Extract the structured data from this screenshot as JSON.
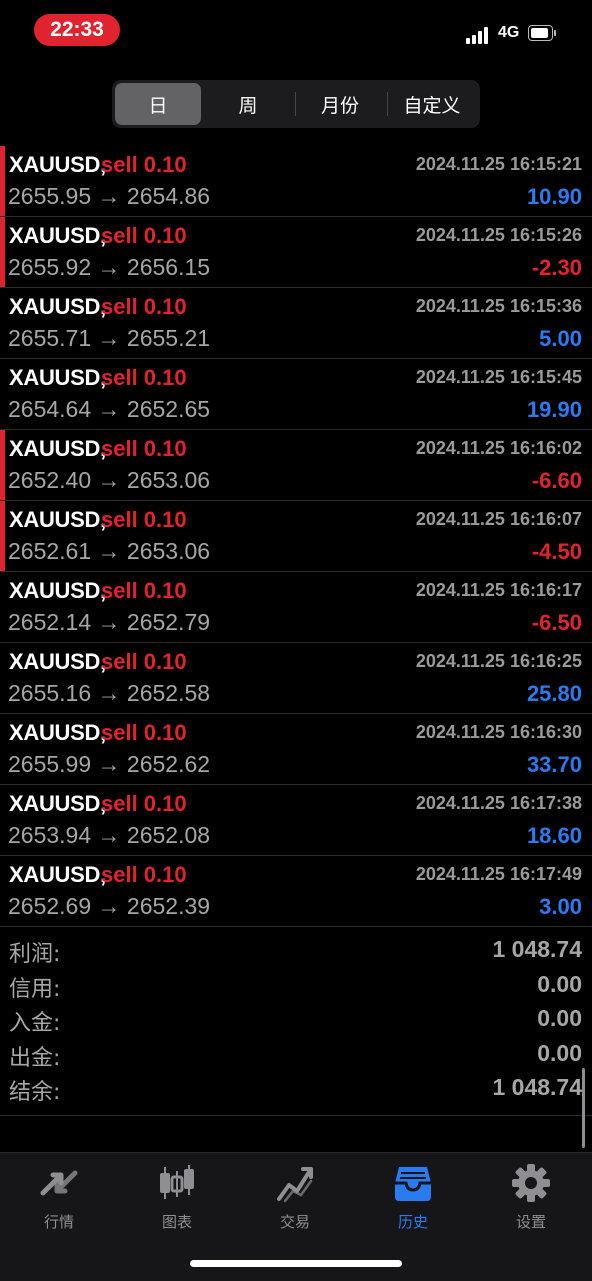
{
  "status_bar": {
    "time": "22:33",
    "network": "4G"
  },
  "period_tabs": [
    "日",
    "周",
    "月份",
    "自定义"
  ],
  "trades": [
    {
      "symbol": "XAUUSD,",
      "side": "sell 0.10",
      "prices": "2655.95 → 2654.86",
      "datetime": "2024.11.25 16:15:21",
      "profit": "10.90",
      "positive": true,
      "flag": true
    },
    {
      "symbol": "XAUUSD,",
      "side": "sell 0.10",
      "prices": "2655.92 → 2656.15",
      "datetime": "2024.11.25 16:15:26",
      "profit": "-2.30",
      "positive": false,
      "flag": true
    },
    {
      "symbol": "XAUUSD,",
      "side": "sell 0.10",
      "prices": "2655.71 → 2655.21",
      "datetime": "2024.11.25 16:15:36",
      "profit": "5.00",
      "positive": true,
      "flag": false
    },
    {
      "symbol": "XAUUSD,",
      "side": "sell 0.10",
      "prices": "2654.64 → 2652.65",
      "datetime": "2024.11.25 16:15:45",
      "profit": "19.90",
      "positive": true,
      "flag": false
    },
    {
      "symbol": "XAUUSD,",
      "side": "sell 0.10",
      "prices": "2652.40 → 2653.06",
      "datetime": "2024.11.25 16:16:02",
      "profit": "-6.60",
      "positive": false,
      "flag": true
    },
    {
      "symbol": "XAUUSD,",
      "side": "sell 0.10",
      "prices": "2652.61 → 2653.06",
      "datetime": "2024.11.25 16:16:07",
      "profit": "-4.50",
      "positive": false,
      "flag": true
    },
    {
      "symbol": "XAUUSD,",
      "side": "sell 0.10",
      "prices": "2652.14 → 2652.79",
      "datetime": "2024.11.25 16:16:17",
      "profit": "-6.50",
      "positive": false,
      "flag": false
    },
    {
      "symbol": "XAUUSD,",
      "side": "sell 0.10",
      "prices": "2655.16 → 2652.58",
      "datetime": "2024.11.25 16:16:25",
      "profit": "25.80",
      "positive": true,
      "flag": false
    },
    {
      "symbol": "XAUUSD,",
      "side": "sell 0.10",
      "prices": "2655.99 → 2652.62",
      "datetime": "2024.11.25 16:16:30",
      "profit": "33.70",
      "positive": true,
      "flag": false
    },
    {
      "symbol": "XAUUSD,",
      "side": "sell 0.10",
      "prices": "2653.94 → 2652.08",
      "datetime": "2024.11.25 16:17:38",
      "profit": "18.60",
      "positive": true,
      "flag": false
    },
    {
      "symbol": "XAUUSD,",
      "side": "sell 0.10",
      "prices": "2652.69 → 2652.39",
      "datetime": "2024.11.25 16:17:49",
      "profit": "3.00",
      "positive": true,
      "flag": false
    }
  ],
  "summary": [
    {
      "label": "利润:",
      "value": "1 048.74"
    },
    {
      "label": "信用:",
      "value": "0.00"
    },
    {
      "label": "入金:",
      "value": "0.00"
    },
    {
      "label": "出金:",
      "value": "0.00"
    },
    {
      "label": "结余:",
      "value": "1 048.74"
    }
  ],
  "tabbar": [
    {
      "label": "行情",
      "icon": "quotes-icon"
    },
    {
      "label": "图表",
      "icon": "chart-icon"
    },
    {
      "label": "交易",
      "icon": "trade-icon"
    },
    {
      "label": "历史",
      "icon": "history-icon",
      "active": true
    },
    {
      "label": "设置",
      "icon": "settings-icon"
    }
  ],
  "colors": {
    "sell": "#e0232e",
    "profit_positive": "#2b7bf0",
    "profit_negative": "#e0232e",
    "active_tab": "#2b7bf0",
    "time_pill": "#e0232e"
  }
}
